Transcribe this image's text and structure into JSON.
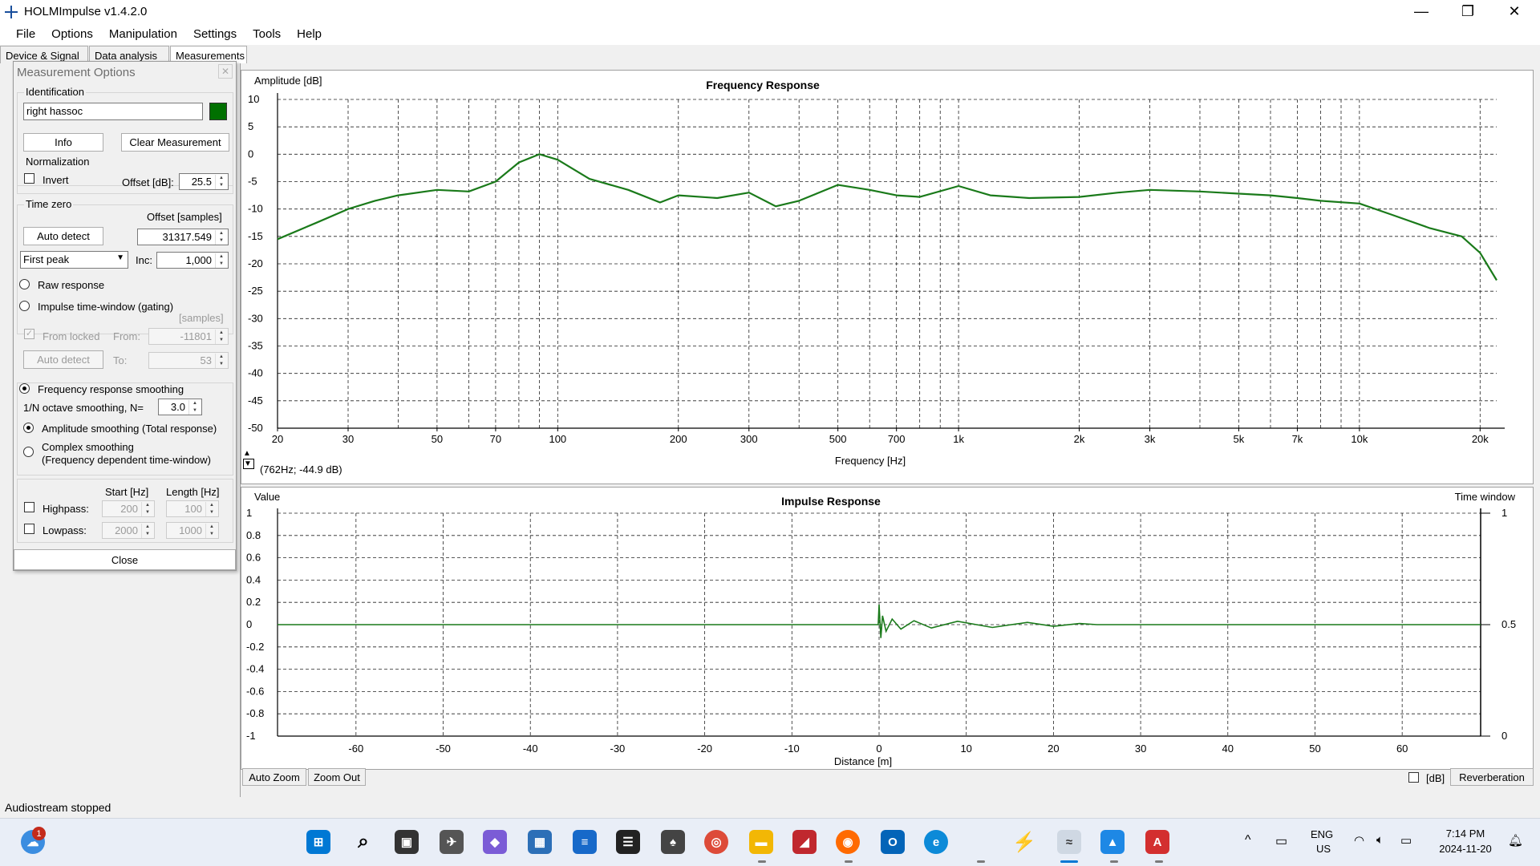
{
  "window": {
    "title": "HOLMImpulse  v1.4.2.0",
    "controls": {
      "minimize": "—",
      "restore": "❐",
      "close": "✕"
    }
  },
  "menu": [
    "File",
    "Options",
    "Manipulation",
    "Settings",
    "Tools",
    "Help"
  ],
  "tabs": [
    "Device & Signal",
    "Data analysis",
    "Measurements"
  ],
  "panel": {
    "title": "Measurement Options",
    "close_glyph": "✕",
    "identification": {
      "label": "Identification",
      "value": "right hassoc",
      "color": "#007000"
    },
    "info_button": "Info",
    "clear_button": "Clear Measurement",
    "normalization": {
      "label": "Normalization",
      "invert_label": "Invert",
      "offset_label": "Offset [dB]:",
      "offset_value": "25.5"
    },
    "time_zero": {
      "label": "Time zero",
      "offset_label": "Offset [samples]",
      "auto_detect": "Auto detect",
      "offset_value": "31317.549",
      "mode_value": "First peak",
      "inc_label": "Inc:",
      "inc_value": "1,000"
    },
    "raw_response": "Raw response",
    "gating": {
      "label": "Impulse time-window (gating)",
      "units": "[samples]",
      "from_locked": "From locked",
      "from_label": "From:",
      "from_value": "-11801",
      "auto_detect": "Auto detect",
      "to_label": "To:",
      "to_value": "53"
    },
    "smoothing": {
      "label": "Frequency response smoothing",
      "octave_label": "1/N octave smoothing, N=",
      "octave_value": "3.0",
      "amplitude_label": "Amplitude smoothing (Total response)",
      "complex_label": "Complex smoothing",
      "complex_sublabel": "(Frequency dependent time-window)"
    },
    "filters": {
      "start_label": "Start [Hz]",
      "length_label": "Length [Hz]",
      "highpass_label": "Highpass:",
      "highpass_start": "200",
      "highpass_length": "100",
      "lowpass_label": "Lowpass:",
      "lowpass_start": "2000",
      "lowpass_length": "1000"
    },
    "close_button": "Close"
  },
  "freq_chart": {
    "cursor_readout": "(762Hz; -44.9 dB)",
    "tick_labels_x": [
      "20",
      "30",
      "50",
      "70",
      "100",
      "200",
      "300",
      "500",
      "700",
      "1k",
      "2k",
      "3k",
      "5k",
      "7k",
      "10k",
      "20k"
    ]
  },
  "impulse_chart": {
    "time_window_label": "Time window",
    "right_ticks": [
      "1",
      "0.5",
      "0"
    ]
  },
  "buttons": {
    "auto_zoom": "Auto Zoom",
    "zoom_out": "Zoom Out",
    "db_label": "[dB]",
    "reverberation": "Reverberation"
  },
  "status": "Audiostream stopped",
  "taskbar": {
    "badge": "1",
    "lang": "ENG",
    "region": "US",
    "time": "7:14 PM",
    "date": "2024-11-20"
  },
  "chart_data": [
    {
      "type": "line",
      "title": "Frequency Response",
      "xlabel": "Frequency [Hz]",
      "ylabel": "Amplitude [dB]",
      "xscale": "log",
      "xlim": [
        20,
        22000
      ],
      "ylim": [
        -50,
        10
      ],
      "yticks": [
        10,
        5,
        0,
        -5,
        -10,
        -15,
        -20,
        -25,
        -30,
        -35,
        -40,
        -45,
        -50
      ],
      "grid": true,
      "series": [
        {
          "color": "#1a7a1a",
          "x": [
            20,
            25,
            30,
            35,
            40,
            50,
            60,
            70,
            80,
            90,
            100,
            120,
            150,
            180,
            200,
            250,
            300,
            350,
            400,
            500,
            600,
            700,
            800,
            1000,
            1200,
            1500,
            2000,
            2500,
            3000,
            4000,
            5000,
            6000,
            7000,
            8000,
            10000,
            12000,
            15000,
            18000,
            20000,
            22000
          ],
          "y": [
            -15.5,
            -12.5,
            -10,
            -8.5,
            -7.5,
            -6.5,
            -6.8,
            -5,
            -1.5,
            0,
            -1,
            -4.5,
            -6.5,
            -8.8,
            -7.5,
            -8,
            -7,
            -9.5,
            -8.5,
            -5.6,
            -6.5,
            -7.5,
            -7.8,
            -5.8,
            -7.5,
            -8,
            -7.8,
            -7,
            -6.5,
            -6.8,
            -7.2,
            -7.5,
            -8,
            -8.5,
            -9,
            -11,
            -13.5,
            -15,
            -18,
            -23
          ]
        }
      ]
    },
    {
      "type": "line",
      "title": "Impulse Response",
      "xlabel": "Distance [m]",
      "ylabel": "Value",
      "xlim": [
        -69,
        69
      ],
      "ylim": [
        -1,
        1
      ],
      "xticks": [
        -60,
        -50,
        -40,
        -30,
        -20,
        -10,
        0,
        10,
        20,
        30,
        40,
        50,
        60
      ],
      "yticks": [
        1,
        0.8,
        0.6,
        0.4,
        0.2,
        0,
        -0.2,
        -0.4,
        -0.6,
        -0.8,
        -1
      ],
      "grid": true,
      "series": [
        {
          "color": "#1a7a1a",
          "x": [
            -69,
            -0.1,
            0,
            0.2,
            0.4,
            0.8,
            1.5,
            2.5,
            4,
            6,
            9,
            13,
            17,
            20,
            23,
            25,
            69
          ],
          "y": [
            0,
            0,
            0.18,
            -0.12,
            0.08,
            -0.06,
            0.05,
            -0.04,
            0.035,
            -0.03,
            0.03,
            -0.025,
            0.02,
            -0.015,
            0.01,
            0,
            0
          ]
        }
      ]
    }
  ]
}
